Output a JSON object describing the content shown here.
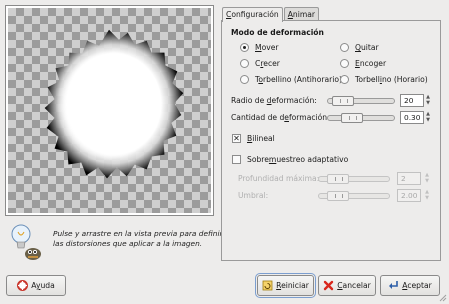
{
  "tabs": [
    {
      "label_pre": "",
      "label_u": "C",
      "label_post": "onfiguración"
    },
    {
      "label_pre": "",
      "label_u": "A",
      "label_post": "nimar"
    }
  ],
  "section_title": "Modo de deformación",
  "modes": [
    {
      "pre": "",
      "u": "M",
      "post": "over",
      "selected": true
    },
    {
      "pre": "",
      "u": "Q",
      "post": "uitar",
      "selected": false
    },
    {
      "pre": "C",
      "u": "r",
      "post": "ecer",
      "selected": false
    },
    {
      "pre": "",
      "u": "E",
      "post": "ncoger",
      "selected": false
    },
    {
      "pre": "T",
      "u": "o",
      "post": "rbellino (Antihorario)",
      "selected": false
    },
    {
      "pre": "Torbell",
      "u": "i",
      "post": "no (Horario)",
      "selected": false
    }
  ],
  "radius": {
    "label_pre": "Radio de ",
    "label_u": "d",
    "label_post": "eformación:",
    "value": "20"
  },
  "amount": {
    "label_pre": "Cantidad de d",
    "label_u": "e",
    "label_post": "formación:",
    "value": "0.30"
  },
  "bilinear": {
    "pre": "",
    "u": "B",
    "post": "ilineal",
    "checked": true
  },
  "supersample": {
    "pre": "Sobre",
    "u": "m",
    "post": "uestreo adaptativo",
    "checked": false
  },
  "max_depth": {
    "label": "Profundidad máxima:",
    "value": "2"
  },
  "threshold": {
    "label": "Umbral:",
    "value": "2.00"
  },
  "hint": "Pulse y arrastre en la vista previa para definir las distorsiones que aplicar a la imagen.",
  "buttons": {
    "help": {
      "pre": "A",
      "u": "y",
      "post": "uda"
    },
    "reset": {
      "pre": "",
      "u": "R",
      "post": "einiciar"
    },
    "cancel": {
      "pre": "",
      "u": "C",
      "post": "ancelar"
    },
    "ok": {
      "pre": "",
      "u": "A",
      "post": "ceptar"
    }
  },
  "icons": {
    "hint": "lightbulb-wilber-icon",
    "help": "lifebuoy-icon",
    "reset": "reset-icon",
    "cancel": "cancel-x-icon",
    "ok": "enter-arrow-icon"
  },
  "colors": {
    "accent": "#7b9ecf",
    "cancel_red": "#d8261c",
    "help_red": "#c9352b"
  }
}
